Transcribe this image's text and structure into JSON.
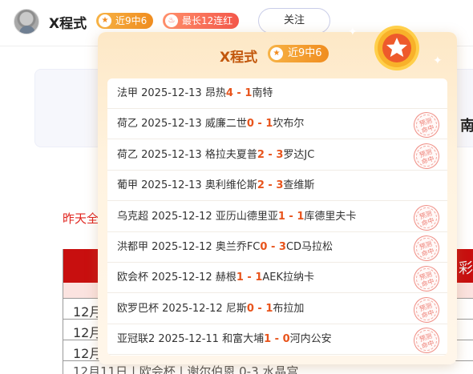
{
  "header": {
    "username": "X程式",
    "badge_hit": "近9中6",
    "badge_streak": "最长12连红",
    "follow_label": "关注"
  },
  "background": {
    "card_text": "南",
    "red_text_left": "昨天全",
    "red_text_right": "!",
    "table_rows": [
      "12月",
      "12月",
      "12月"
    ],
    "last_row": "12月11日 | 欧会杯 | 谢尔伯恩 0-3 水晶宫",
    "right_text": "彩"
  },
  "popup": {
    "title": "X程式",
    "badge": "近9中6",
    "stamp_text": [
      "预测",
      "命中"
    ],
    "matches": [
      {
        "league": "法甲",
        "date": "2025-12-13",
        "home": "昂热",
        "home_score": "4",
        "sep": " - ",
        "away_score": "1",
        "away": "南特",
        "hit": false
      },
      {
        "league": "荷乙",
        "date": "2025-12-13",
        "home": "威廉二世",
        "home_score": "0",
        "sep": " - ",
        "away_score": "1",
        "away": "坎布尔",
        "hit": true
      },
      {
        "league": "荷乙",
        "date": "2025-12-13",
        "home": "格拉夫夏普",
        "home_score": "2",
        "sep": " - ",
        "away_score": "3",
        "away": "罗达JC",
        "hit": true
      },
      {
        "league": "葡甲",
        "date": "2025-12-13",
        "home": "奥利维伦斯",
        "home_score": "2",
        "sep": " - ",
        "away_score": "3",
        "away": "查维斯",
        "hit": false
      },
      {
        "league": "乌克超",
        "date": "2025-12-12",
        "home": "亚历山德里亚",
        "home_score": "1",
        "sep": " - ",
        "away_score": "1",
        "away": "库德里夫卡",
        "hit": true
      },
      {
        "league": "洪都甲",
        "date": "2025-12-12",
        "home": "奥兰乔FC",
        "home_score": "0",
        "sep": " - ",
        "away_score": "3",
        "away": "CD马拉松",
        "hit": true
      },
      {
        "league": "欧会杯",
        "date": "2025-12-12",
        "home": "赫根",
        "home_score": "1",
        "sep": " - ",
        "away_score": "1",
        "away": "AEK拉纳卡",
        "hit": true
      },
      {
        "league": "欧罗巴杯",
        "date": "2025-12-12",
        "home": "尼斯",
        "home_score": "0",
        "sep": " - ",
        "away_score": "1",
        "away": "布拉加",
        "hit": true
      },
      {
        "league": "亚冠联2",
        "date": "2025-12-11",
        "home": "和富大埔",
        "home_score": "1",
        "sep": " - ",
        "away_score": "0",
        "away": "河内公安",
        "hit": true
      }
    ]
  },
  "icons": {
    "badge_icon": "star-icon",
    "streak_icon": "flame-icon",
    "medal_icon": "star-medal-icon"
  },
  "colors": {
    "accent_orange": "#f08d1f",
    "score_red": "#e8541c",
    "title_brown": "#c2570c",
    "streak_red": "#f4574a"
  }
}
